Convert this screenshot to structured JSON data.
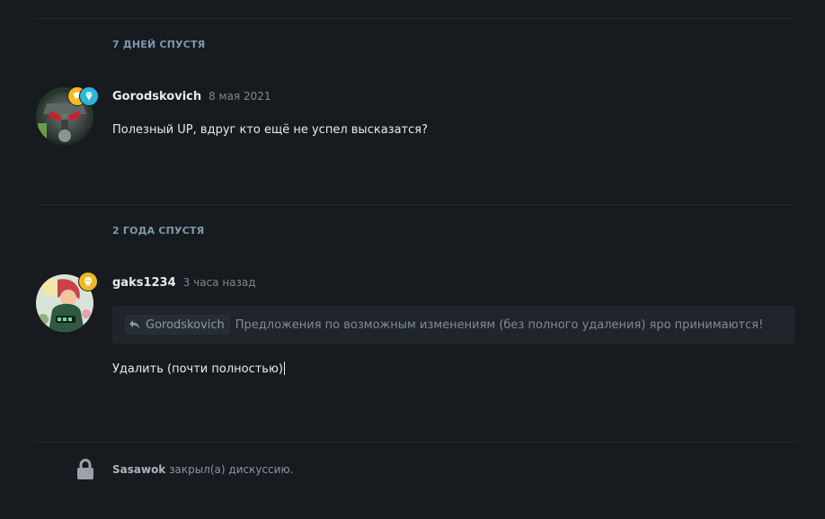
{
  "thread": {
    "sections": [
      {
        "time_separator": "7 ДНЕЙ СПУСТЯ",
        "post": {
          "author": "Gorodskovich",
          "date": "8 мая 2021",
          "text": "Полезный UP, вдруг кто ещё не успел высказатся?",
          "avatar_icon": "robot-helmet-avatar",
          "badges": [
            "reaction-badge",
            "diamond-badge"
          ]
        }
      },
      {
        "time_separator": "2 ГОДА СПУСТЯ",
        "post": {
          "author": "gaks1234",
          "date": "3 часа назад",
          "quote_author": "Gorodskovich",
          "quote_text": "Предложения по возможным изменениям (без полного удаления) яро принимаются!",
          "text": "Удалить (почти полностью)",
          "avatar_icon": "character-avatar",
          "badges": [
            "skull-badge"
          ]
        }
      }
    ],
    "closed_notice": {
      "user": "Sasawok",
      "text": "закрыл(а) дискуссию.",
      "icon": "lock-icon"
    }
  },
  "colors": {
    "background": "#171b1f",
    "section_header": "#7f98ad",
    "badge_gold": "#f2b825",
    "badge_teal": "#29b6d9"
  }
}
